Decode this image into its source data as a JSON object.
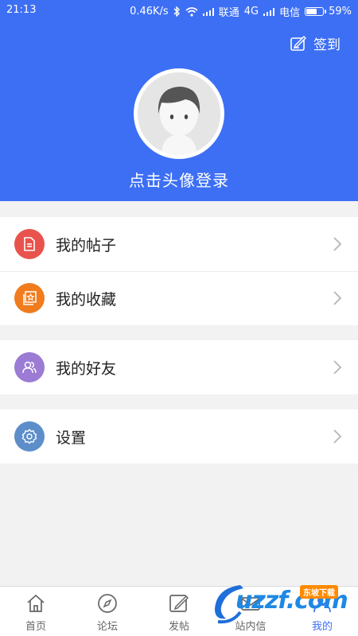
{
  "status_bar": {
    "time": "21:13",
    "speed": "0.46K/s",
    "carrier1": "联通",
    "network": "4G",
    "carrier2": "电信",
    "battery_text": "59%",
    "battery_level": 0.59
  },
  "header": {
    "checkin_label": "签到",
    "login_hint": "点击头像登录",
    "bg_color": "#3d6ff5"
  },
  "menu": {
    "my_posts": {
      "label": "我的帖子",
      "icon": "document-icon",
      "color": "#e8534e"
    },
    "my_favorites": {
      "label": "我的收藏",
      "icon": "star-icon",
      "color": "#f07c1e"
    },
    "my_friends": {
      "label": "我的好友",
      "icon": "friends-icon",
      "color": "#9b7bd4"
    },
    "settings": {
      "label": "设置",
      "icon": "gear-icon",
      "color": "#5d8ec9"
    }
  },
  "tabbar": {
    "tabs": [
      {
        "label": "首页",
        "icon": "home-icon"
      },
      {
        "label": "论坛",
        "icon": "compass-icon"
      },
      {
        "label": "发帖",
        "icon": "compose-icon"
      },
      {
        "label": "站内信",
        "icon": "mail-icon"
      },
      {
        "label": "我的",
        "icon": "person-icon"
      }
    ],
    "active_index": 4
  },
  "watermark": {
    "text": "uzzf.com",
    "tag": "东坡下载"
  }
}
